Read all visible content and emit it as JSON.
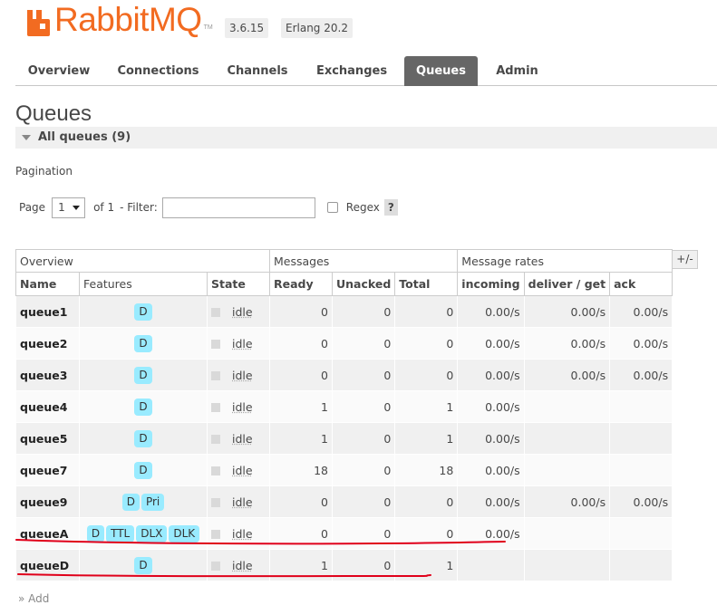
{
  "header": {
    "brand": "RabbitMQ",
    "trademark": "TM",
    "version": "3.6.15",
    "erlang": "Erlang 20.2",
    "colors": {
      "brand": "#f26b21",
      "active_tab": "#666666",
      "feature_tag": "#99ebff",
      "annotation": "#e0001a"
    }
  },
  "nav": {
    "tabs": [
      {
        "label": "Overview"
      },
      {
        "label": "Connections"
      },
      {
        "label": "Channels"
      },
      {
        "label": "Exchanges"
      },
      {
        "label": "Queues",
        "active": true
      },
      {
        "label": "Admin"
      }
    ]
  },
  "page": {
    "title": "Queues",
    "section_label": "All queues (9)",
    "pagination_label": "Pagination",
    "page_label": "Page",
    "page_value": "1",
    "of_label": "of 1",
    "filter_label": "- Filter:",
    "filter_value": "",
    "regex_label": "Regex",
    "help_label": "?",
    "columns_toggle": "+/-"
  },
  "table": {
    "groups": [
      "Overview",
      "Messages",
      "Message rates"
    ],
    "columns": [
      "Name",
      "Features",
      "State",
      "Ready",
      "Unacked",
      "Total",
      "incoming",
      "deliver / get",
      "ack"
    ],
    "rows": [
      {
        "name": "queue1",
        "features": [
          "D"
        ],
        "state": "idle",
        "ready": "0",
        "unacked": "0",
        "total": "0",
        "incoming": "0.00/s",
        "deliver": "0.00/s",
        "ack": "0.00/s"
      },
      {
        "name": "queue2",
        "features": [
          "D"
        ],
        "state": "idle",
        "ready": "0",
        "unacked": "0",
        "total": "0",
        "incoming": "0.00/s",
        "deliver": "0.00/s",
        "ack": "0.00/s"
      },
      {
        "name": "queue3",
        "features": [
          "D"
        ],
        "state": "idle",
        "ready": "0",
        "unacked": "0",
        "total": "0",
        "incoming": "0.00/s",
        "deliver": "0.00/s",
        "ack": "0.00/s"
      },
      {
        "name": "queue4",
        "features": [
          "D"
        ],
        "state": "idle",
        "ready": "1",
        "unacked": "0",
        "total": "1",
        "incoming": "0.00/s",
        "deliver": "",
        "ack": ""
      },
      {
        "name": "queue5",
        "features": [
          "D"
        ],
        "state": "idle",
        "ready": "1",
        "unacked": "0",
        "total": "1",
        "incoming": "0.00/s",
        "deliver": "",
        "ack": ""
      },
      {
        "name": "queue7",
        "features": [
          "D"
        ],
        "state": "idle",
        "ready": "18",
        "unacked": "0",
        "total": "18",
        "incoming": "0.00/s",
        "deliver": "",
        "ack": ""
      },
      {
        "name": "queue9",
        "features": [
          "D",
          "Pri"
        ],
        "state": "idle",
        "ready": "0",
        "unacked": "0",
        "total": "0",
        "incoming": "0.00/s",
        "deliver": "0.00/s",
        "ack": "0.00/s"
      },
      {
        "name": "queueA",
        "features": [
          "D",
          "TTL",
          "DLX",
          "DLK"
        ],
        "state": "idle",
        "ready": "0",
        "unacked": "0",
        "total": "0",
        "incoming": "0.00/s",
        "deliver": "",
        "ack": ""
      },
      {
        "name": "queueD",
        "features": [
          "D"
        ],
        "state": "idle",
        "ready": "1",
        "unacked": "0",
        "total": "1",
        "incoming": "",
        "deliver": "",
        "ack": ""
      }
    ]
  },
  "footer": {
    "add_queue_label": "» Add"
  }
}
